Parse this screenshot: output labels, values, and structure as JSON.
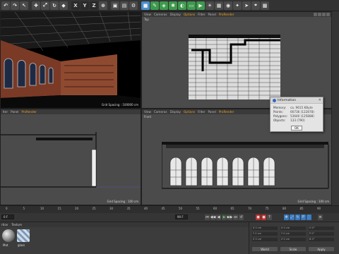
{
  "toolbar": {
    "icons": [
      {
        "name": "undo-icon",
        "glyph": "↶"
      },
      {
        "name": "redo-icon",
        "glyph": "↷"
      },
      {
        "name": "live-selection-icon",
        "glyph": "↖"
      },
      {
        "name": "move-icon",
        "glyph": "✚"
      },
      {
        "name": "scale-icon",
        "glyph": "⤢"
      },
      {
        "name": "rotate-icon",
        "glyph": "↻"
      },
      {
        "name": "model-mode-icon",
        "glyph": "◆"
      },
      {
        "name": "x-axis-icon",
        "glyph": "X"
      },
      {
        "name": "y-axis-icon",
        "glyph": "Y"
      },
      {
        "name": "z-axis-icon",
        "glyph": "Z"
      },
      {
        "name": "coordinate-system-icon",
        "glyph": "⊕"
      },
      {
        "name": "render-view-icon",
        "glyph": "▣"
      },
      {
        "name": "render-picture-viewer-icon",
        "glyph": "▤"
      },
      {
        "name": "render-settings-icon",
        "glyph": "⚙"
      },
      {
        "name": "cube-icon",
        "glyph": "■"
      },
      {
        "name": "pen-icon",
        "glyph": "✎"
      },
      {
        "name": "subdivision-icon",
        "glyph": "◈"
      },
      {
        "name": "array-icon",
        "glyph": "✱"
      },
      {
        "name": "deformer-icon",
        "glyph": "◐"
      },
      {
        "name": "floor-icon",
        "glyph": "▭"
      },
      {
        "name": "camera-icon",
        "glyph": "▶"
      },
      {
        "name": "light-icon",
        "glyph": "☀"
      },
      {
        "name": "render-region-icon",
        "glyph": "▦"
      },
      {
        "name": "interactive-render-icon",
        "glyph": "◉"
      },
      {
        "name": "prorender-icon",
        "glyph": "✦"
      },
      {
        "name": "motion-icon",
        "glyph": "➤"
      },
      {
        "name": "snap-icon",
        "glyph": "⌖"
      },
      {
        "name": "workplane-icon",
        "glyph": "▩"
      }
    ]
  },
  "viewports": {
    "perspective": {
      "grid_spacing": "Grid Spacing : 100000 cm"
    },
    "top": {
      "menu": [
        "View",
        "Cameras",
        "Display",
        "Options",
        "Filter",
        "Panel",
        "ProRender"
      ],
      "name": "Top"
    },
    "right": {
      "menu": [
        "View",
        "Cameras",
        "Display",
        "Options",
        "Filter",
        "Panel",
        "ProRender"
      ],
      "menu_visible": [
        "lter",
        "Panel",
        "ProRender"
      ],
      "grid_spacing": "Grid Spacing : 100 cm"
    },
    "front": {
      "menu": [
        "View",
        "Cameras",
        "Display",
        "Options",
        "Filter",
        "Panel",
        "ProRender"
      ],
      "name": "Front",
      "grid_spacing": "Grid Spacing : 100 cm"
    }
  },
  "timeline": {
    "ticks": [
      "0",
      "5",
      "10",
      "15",
      "20",
      "25",
      "30",
      "35",
      "40",
      "45",
      "50",
      "55",
      "60",
      "65",
      "70",
      "75",
      "80",
      "85",
      "90"
    ],
    "frame_label": "0 F"
  },
  "transport": {
    "current_frame": "0 F",
    "start_frame": "0 F",
    "end_frame": "90 F",
    "preview_end": "90 F"
  },
  "materials": {
    "tabs": [
      "rtion",
      "Texture"
    ],
    "items": [
      {
        "name": "Mat",
        "color": "#c8c8c8"
      },
      {
        "name": "glass",
        "color": "#8aa8c8"
      }
    ]
  },
  "coordinates": {
    "rows": [
      {
        "a": "X  0 cm",
        "b": "X  0 cm",
        "c": "H  0°"
      },
      {
        "a": "Y  0 cm",
        "b": "Y  0 cm",
        "c": "P  0°"
      },
      {
        "a": "Z  0 cm",
        "b": "Z  0 cm",
        "c": "B  0°"
      }
    ],
    "mode": "World",
    "scale": "Scale",
    "apply": "Apply"
  },
  "dialog": {
    "title": "Information",
    "rows": [
      {
        "key": "Memory:",
        "value": "ca. 9615 KByte"
      },
      {
        "key": "Points:",
        "value": "66736 (122878)"
      },
      {
        "key": "Polygons:",
        "value": "53640 (125888)"
      },
      {
        "key": "Objects:",
        "value": "133 (790)"
      }
    ],
    "ok": "OK"
  },
  "colors": {
    "accent": "#f0a020",
    "viewport_bg": "#4b4b4b",
    "dialog_bg": "#e4e4e4"
  }
}
